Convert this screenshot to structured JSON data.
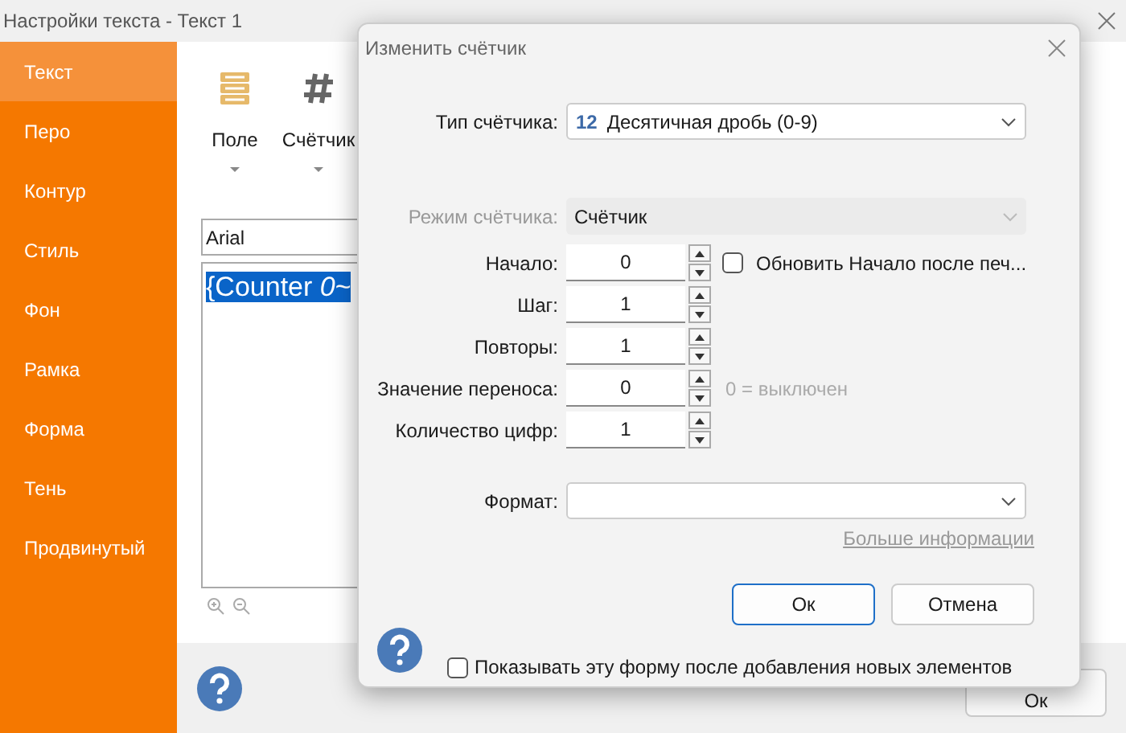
{
  "window": {
    "title": "Настройки текста - Текст 1"
  },
  "sidebar": {
    "items": [
      {
        "label": "Текст",
        "selected": true
      },
      {
        "label": "Перо",
        "selected": false
      },
      {
        "label": "Контур",
        "selected": false
      },
      {
        "label": "Стиль",
        "selected": false
      },
      {
        "label": "Фон",
        "selected": false
      },
      {
        "label": "Рамка",
        "selected": false
      },
      {
        "label": "Форма",
        "selected": false
      },
      {
        "label": "Тень",
        "selected": false
      },
      {
        "label": "Продвинутый",
        "selected": false
      }
    ]
  },
  "toolbar": {
    "buttons": [
      {
        "label": "Поле",
        "kind": "field"
      },
      {
        "label": "Счётчик",
        "kind": "counter"
      }
    ]
  },
  "font_field": {
    "value": "Arial"
  },
  "editor": {
    "text": "{Counter *0*~"
  },
  "footer": {
    "ok_button": "Ок"
  },
  "dialog": {
    "title": "Изменить счётчик",
    "type_combo": {
      "label": "Тип счётчика:",
      "badge": "12",
      "value": "Десятичная дробь (0-9)",
      "disabled": false
    },
    "mode_combo": {
      "label": "Режим счётчика:",
      "value": "Счётчик",
      "disabled": true
    },
    "spins": [
      {
        "label": "Начало:",
        "value": "0",
        "checkbox": {
          "label": "Обновить Начало после печ...",
          "checked": false
        }
      },
      {
        "label": "Шаг:",
        "value": "1"
      },
      {
        "label": "Повторы:",
        "value": "1"
      },
      {
        "label": "Значение переноса:",
        "value": "0",
        "hint": "0 = выключен"
      },
      {
        "label": "Количество цифр:",
        "value": "1"
      }
    ],
    "format_combo": {
      "label": "Формат:"
    },
    "link": "Больше информации",
    "buttons": [
      {
        "label": "Ок",
        "default": true
      },
      {
        "label": "Отмена",
        "default": false
      }
    ],
    "show_checkbox": {
      "label": "Показывать эту форму после добавления новых элементов",
      "checked": false
    }
  }
}
